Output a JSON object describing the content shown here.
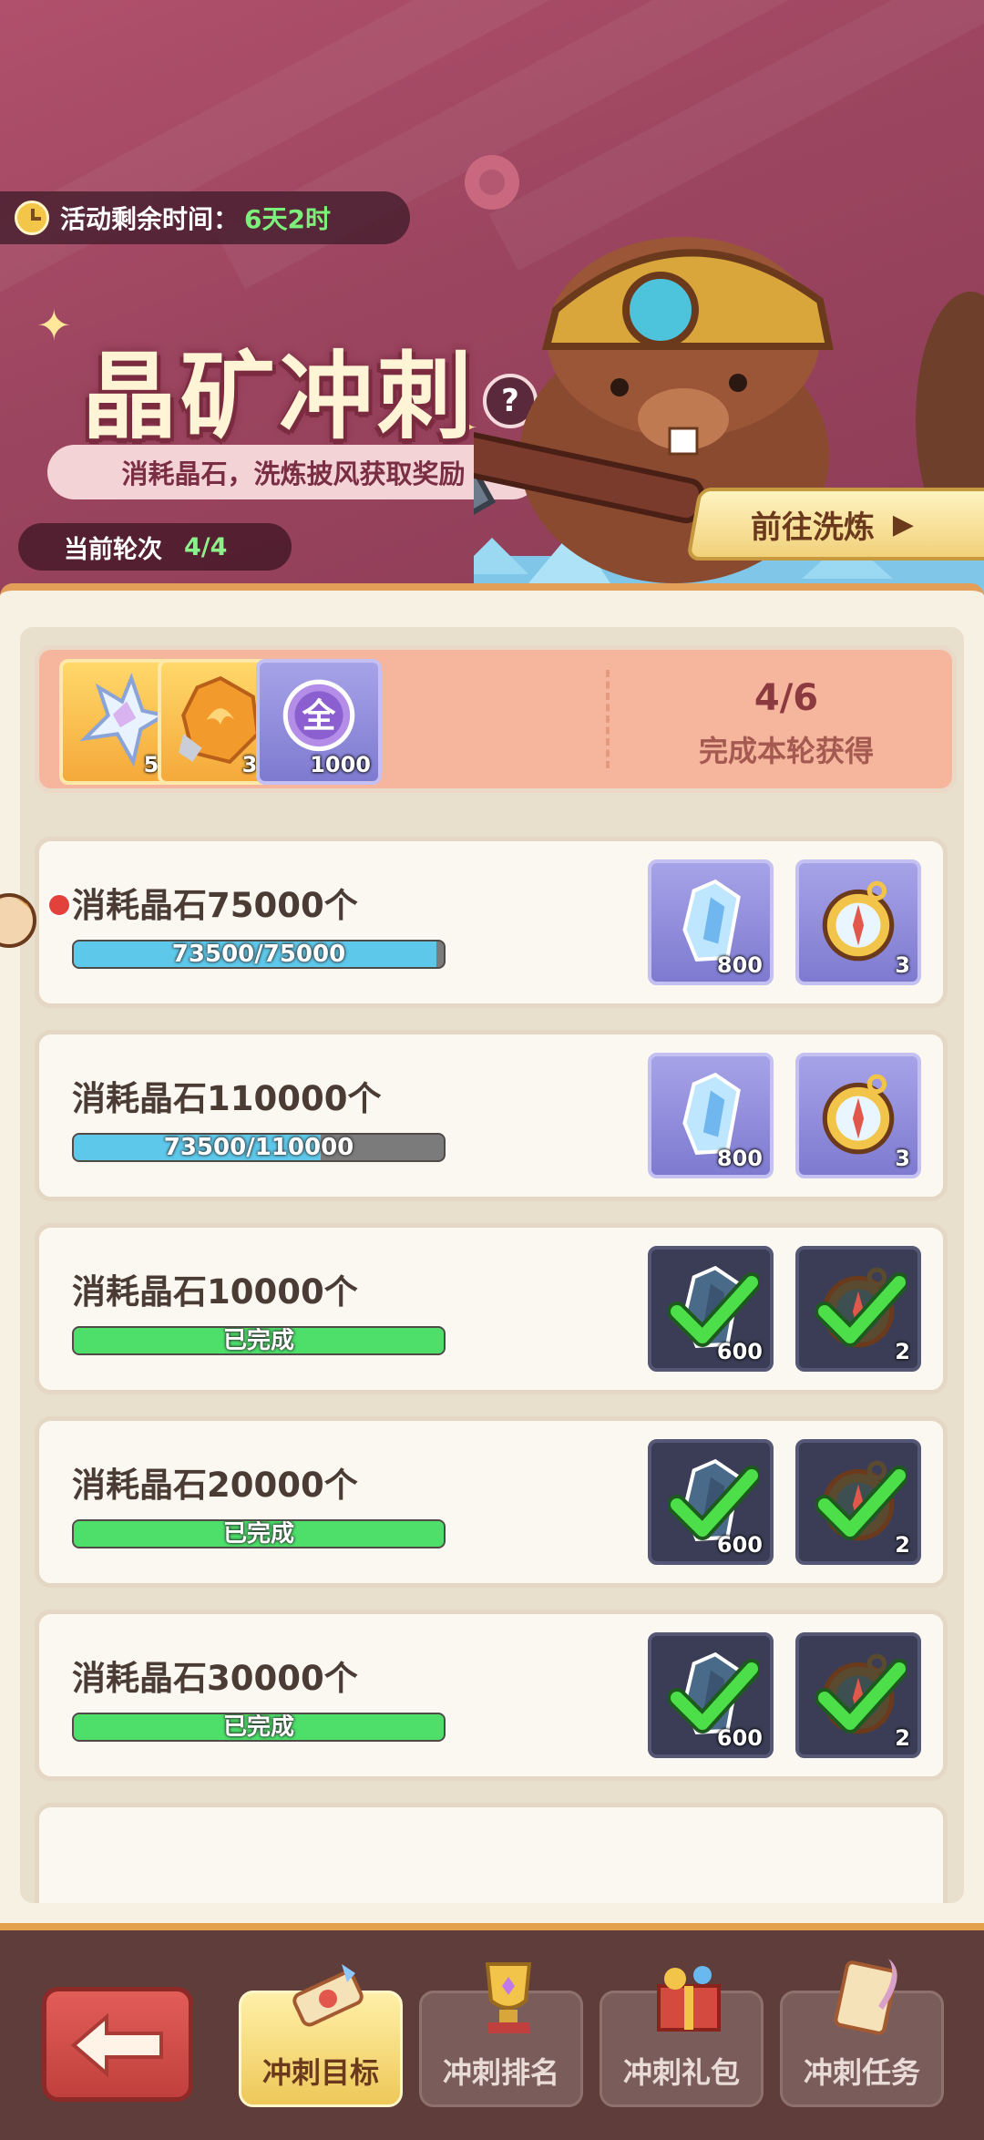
{
  "header": {
    "timer_label": "活动剩余时间：",
    "timer_value": "6天2时",
    "title": "晶矿冲刺",
    "help": "?",
    "subtitle": "消耗晶石，洗炼披风获取奖励",
    "round_label": "当前轮次",
    "round_value": "4/4",
    "goto_label": "前往洗炼"
  },
  "summary": {
    "rewards": [
      {
        "icon": "star-crystal-icon",
        "qty": "50"
      },
      {
        "icon": "fire-ore-icon",
        "qty": "36"
      },
      {
        "icon": "all-token-icon",
        "qty": "1000",
        "symbol": "全"
      }
    ],
    "progress": "4/6",
    "caption": "完成本轮获得"
  },
  "tasks": [
    {
      "name": "消耗晶石75000个",
      "progress_text": "73500/75000",
      "progress": 0.98,
      "state": "in_progress",
      "rewards": [
        {
          "icon": "crystal-icon",
          "qty": "800"
        },
        {
          "icon": "compass-icon",
          "qty": "3"
        }
      ]
    },
    {
      "name": "消耗晶石110000个",
      "progress_text": "73500/110000",
      "progress": 0.668,
      "state": "in_progress",
      "rewards": [
        {
          "icon": "crystal-icon",
          "qty": "800"
        },
        {
          "icon": "compass-icon",
          "qty": "3"
        }
      ]
    },
    {
      "name": "消耗晶石10000个",
      "progress_text": "已完成",
      "progress": 1.0,
      "state": "done",
      "rewards": [
        {
          "icon": "crystal-icon",
          "qty": "600"
        },
        {
          "icon": "compass-icon",
          "qty": "2"
        }
      ]
    },
    {
      "name": "消耗晶石20000个",
      "progress_text": "已完成",
      "progress": 1.0,
      "state": "done",
      "rewards": [
        {
          "icon": "crystal-icon",
          "qty": "600"
        },
        {
          "icon": "compass-icon",
          "qty": "2"
        }
      ]
    },
    {
      "name": "消耗晶石30000个",
      "progress_text": "已完成",
      "progress": 1.0,
      "state": "done",
      "rewards": [
        {
          "icon": "crystal-icon",
          "qty": "600"
        },
        {
          "icon": "compass-icon",
          "qty": "2"
        }
      ]
    }
  ],
  "nav": {
    "back_icon": "back-arrow-icon",
    "tabs": [
      {
        "label": "冲刺目标",
        "icon": "scroll-icon",
        "active": true
      },
      {
        "label": "冲刺排名",
        "icon": "trophy-icon",
        "active": false
      },
      {
        "label": "冲刺礼包",
        "icon": "gift-icon",
        "active": false
      },
      {
        "label": "冲刺任务",
        "icon": "quest-scroll-icon",
        "active": false
      }
    ]
  },
  "colors": {
    "banner": "#9c4560",
    "progress_blue": "#5ec8ea",
    "progress_green": "#4ddf6a",
    "accent_gold": "#f1d17a"
  }
}
